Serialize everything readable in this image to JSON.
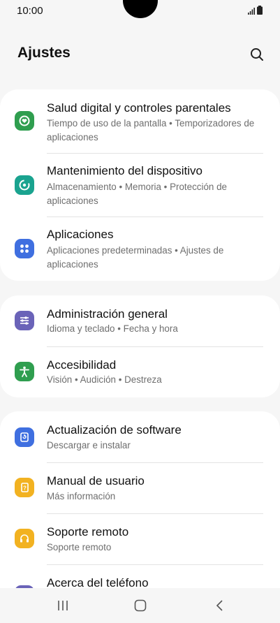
{
  "status_bar": {
    "time": "10:00"
  },
  "header": {
    "title": "Ajustes"
  },
  "cards": [
    {
      "items": [
        {
          "title": "Salud digital y controles parentales",
          "subtitle": "Tiempo de uso de la pantalla • Temporizadores de aplicaciones",
          "icon": "digital-wellbeing-icon",
          "color": "#2f9e4f"
        },
        {
          "title": "Mantenimiento del dispositivo",
          "subtitle": "Almacenamiento • Memoria • Protección de aplicaciones",
          "icon": "device-care-icon",
          "color": "#1aa38f"
        },
        {
          "title": "Aplicaciones",
          "subtitle": "Aplicaciones predeterminadas • Ajustes de aplicaciones",
          "icon": "apps-icon",
          "color": "#3f6fe0"
        }
      ]
    },
    {
      "items": [
        {
          "title": "Administración general",
          "subtitle": "Idioma y teclado • Fecha y hora",
          "icon": "general-management-icon",
          "color": "#6a63b8"
        },
        {
          "title": "Accesibilidad",
          "subtitle": "Visión • Audición • Destreza",
          "icon": "accessibility-icon",
          "color": "#2f9e4f"
        }
      ]
    },
    {
      "items": [
        {
          "title": "Actualización de software",
          "subtitle": "Descargar e instalar",
          "icon": "software-update-icon",
          "color": "#3f6fe0"
        },
        {
          "title": "Manual de usuario",
          "subtitle": "Más información",
          "icon": "user-manual-icon",
          "color": "#f2b221"
        },
        {
          "title": "Soporte remoto",
          "subtitle": "Soporte remoto",
          "icon": "remote-support-icon",
          "color": "#f2b221"
        },
        {
          "title": "Acerca del teléfono",
          "subtitle": "",
          "icon": "about-phone-icon",
          "color": "#6a63b8"
        }
      ]
    }
  ]
}
